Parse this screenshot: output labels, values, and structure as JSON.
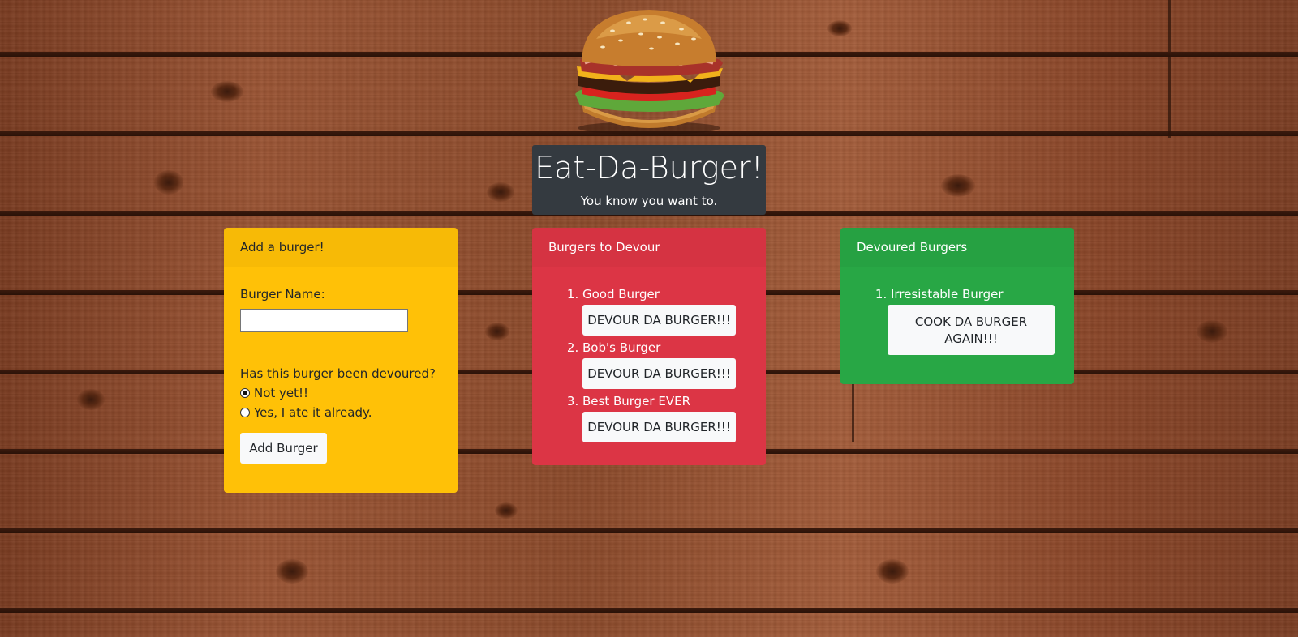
{
  "header": {
    "title": "Eat-Da-Burger!",
    "tagline": "You know you want to."
  },
  "add_card": {
    "header": "Add a burger!",
    "name_label": "Burger Name:",
    "name_value": "",
    "question": "Has this burger been devoured?",
    "radio_options": [
      {
        "label": "Not yet!!",
        "checked": true
      },
      {
        "label": "Yes, I ate it already.",
        "checked": false
      }
    ],
    "submit_label": "Add Burger"
  },
  "devour_card": {
    "header": "Burgers to Devour",
    "burgers": [
      {
        "name": "Good Burger",
        "button": "DEVOUR DA BURGER!!!"
      },
      {
        "name": "Bob's Burger",
        "button": "DEVOUR DA BURGER!!!"
      },
      {
        "name": "Best Burger EVER",
        "button": "DEVOUR DA BURGER!!!"
      }
    ]
  },
  "devoured_card": {
    "header": "Devoured Burgers",
    "burgers": [
      {
        "name": "Irresistable Burger",
        "button": "COOK DA BURGER AGAIN!!!"
      }
    ]
  },
  "colors": {
    "yellow": "#ffc107",
    "red": "#dc3545",
    "green": "#28a745",
    "dark": "#343a40",
    "light": "#f8f9fa"
  }
}
